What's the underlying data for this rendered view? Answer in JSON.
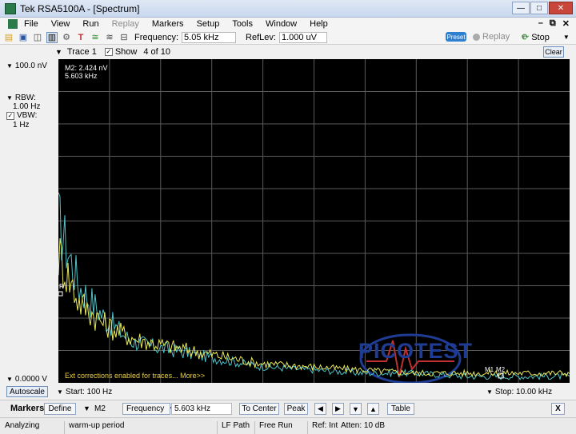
{
  "window": {
    "title": "Tek RSA5100A - [Spectrum]"
  },
  "menu": [
    "File",
    "View",
    "Run",
    "Replay",
    "Markers",
    "Setup",
    "Tools",
    "Window",
    "Help"
  ],
  "toolbar": {
    "frequency_label": "Frequency:",
    "frequency_value": "5.05 kHz",
    "reflev_label": "RefLev:",
    "reflev_value": "1.000 uV",
    "preset_label": "Preset",
    "replay_label": "Replay",
    "stop_label": "Stop"
  },
  "trace": {
    "trace_label": "Trace 1",
    "show_label": "Show",
    "count_label": "4 of 10",
    "clear_label": "Clear"
  },
  "left_panel": {
    "ref_level": "100.0 nV",
    "rbw_label": "RBW:",
    "rbw_value": "1.00 Hz",
    "vbw_label": "VBW:",
    "vbw_value": "1 Hz",
    "bottom_level": "0.0000 V",
    "autoscale_label": "Autoscale"
  },
  "plot": {
    "marker_readout_line1": "M2: 2.424 nV",
    "marker_readout_line2": "5.603 kHz",
    "ext_message": "Ext corrections enabled for traces... More>>",
    "marker_tag_m1": "M1",
    "marker_tag_m2": "M2",
    "ref_tag": "R",
    "watermark": "PICOTEST"
  },
  "span": {
    "start_label": "Start: 100 Hz",
    "stop_label": "Stop: 10.00 kHz"
  },
  "markers_bar": {
    "title": "Markers",
    "define_label": "Define",
    "marker_select": "M2",
    "measure_select": "Frequency",
    "marker_value": "5.603 kHz",
    "to_center_label": "To Center",
    "peak_label": "Peak",
    "table_label": "Table",
    "close_label": "X"
  },
  "status": {
    "state": "Analyzing",
    "message": "warm-up period",
    "lf_path": "LF Path",
    "run_mode": "Free Run",
    "ref": "Ref: Int",
    "atten": "Atten: 10 dB"
  },
  "chart_data": {
    "type": "line",
    "x_range": [
      100,
      10000
    ],
    "x_unit": "Hz",
    "y_range": [
      0,
      100
    ],
    "y_unit": "nV",
    "grid": true,
    "series": [
      {
        "color": "#4fc3c8",
        "x": [
          100,
          500,
          1000,
          1500,
          2000,
          3000,
          4000,
          5000,
          6000,
          7000,
          8000,
          9000,
          10000
        ],
        "y": [
          50,
          30,
          20,
          13,
          11,
          8,
          5,
          4,
          3,
          3,
          2,
          2,
          2
        ]
      },
      {
        "color": "#e8e85a",
        "x": [
          100,
          500,
          1000,
          1500,
          2000,
          3000,
          4000,
          5000,
          6000,
          7000,
          8000,
          9000,
          10000
        ],
        "y": [
          40,
          25,
          18,
          14,
          12,
          9,
          6,
          5,
          4,
          3,
          3,
          3,
          3
        ]
      }
    ]
  }
}
